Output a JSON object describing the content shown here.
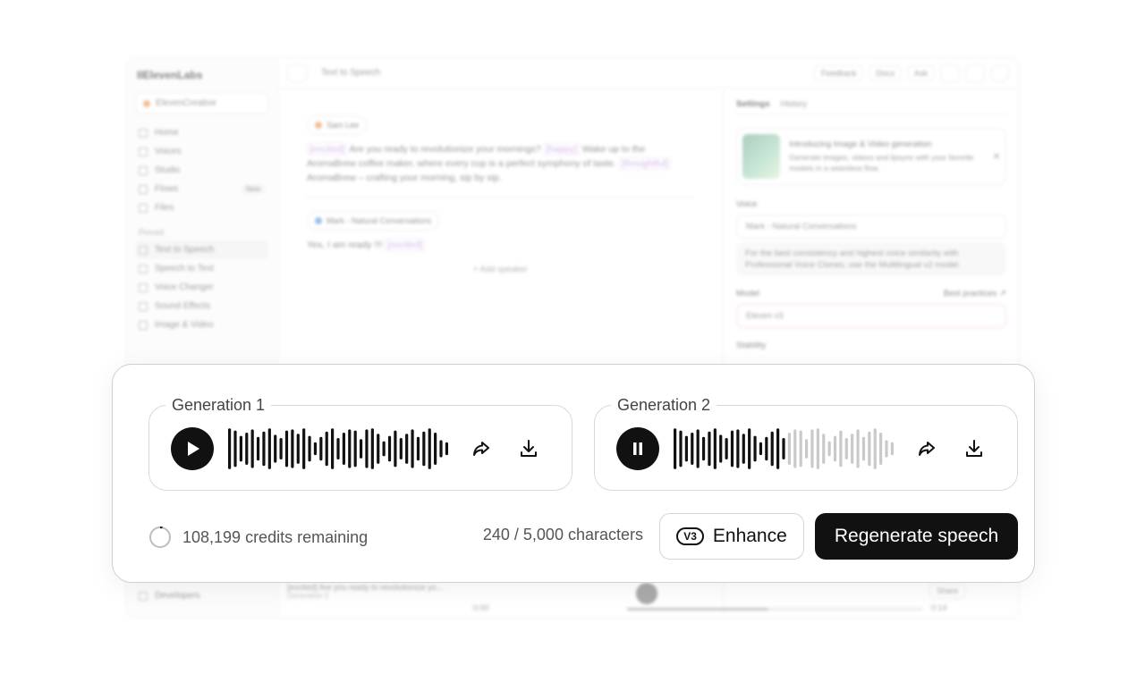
{
  "app": {
    "logo": "IIElevenLabs",
    "workspace": "ElevenCreative",
    "nav": [
      {
        "label": "Home"
      },
      {
        "label": "Voices"
      },
      {
        "label": "Studio"
      },
      {
        "label": "Flows",
        "badge": "New"
      }
    ],
    "files_label": "Files",
    "pinned_title": "Pinned",
    "pinned": [
      {
        "label": "Text to Speech",
        "active": true
      },
      {
        "label": "Speech to Text"
      },
      {
        "label": "Voice Changer"
      },
      {
        "label": "Sound Effects"
      },
      {
        "label": "Image & Video"
      }
    ],
    "developers_label": "Developers",
    "page_title": "Text to Speech",
    "top_actions": {
      "feedback": "Feedback",
      "docs": "Docs",
      "ask": "Ask"
    }
  },
  "editor": {
    "speaker1": "Sam Lee",
    "speaker1_tag1": "[excited]",
    "speaker1_text1": "Are you ready to revolutionize your mornings?",
    "speaker1_tag2": "[happy]",
    "speaker1_text2": "Wake up to the AromaBrew coffee maker, where every cup is a perfect symphony of taste.",
    "speaker1_tag3": "[thoughtful]",
    "speaker1_text3": "AromaBrew – crafting your morning, sip by sip.",
    "speaker2": "Mark - Natural Conversations",
    "speaker2_text": "Yes, I am ready !!!",
    "speaker2_tag": "[excited]",
    "add_speaker": "+ Add speaker"
  },
  "settings": {
    "tabs": [
      "Settings",
      "History"
    ],
    "promo_title": "Introducing Image & Video generation",
    "promo_text": "Generate images, videos and lipsync with your favorite models in a seamless flow.",
    "voice_label": "Voice",
    "voice_value": "Mark - Natural Conversations",
    "voice_note": "For the best consistency and highest voice similarity with Professional Voice Clones, use the Multilingual v2 model.",
    "model_label": "Model",
    "best_practices": "Best practices ↗",
    "model_value": "Eleven v3",
    "stability_label": "Stability"
  },
  "player": {
    "now_playing": "[excited] Are you ready to revolutionize yo...",
    "subtitle": "Generation 2",
    "time_start": "0:00",
    "time_end": "0:14",
    "share": "Share",
    "progress": 0.48
  },
  "generations": [
    {
      "label": "Generation 1",
      "state": "paused",
      "played_fraction": 1.0
    },
    {
      "label": "Generation 2",
      "state": "playing",
      "played_fraction": 0.5
    }
  ],
  "footer": {
    "credits": "108,199 credits remaining",
    "characters": "240 / 5,000 characters",
    "enhance_badge": "V3",
    "enhance_label": "Enhance",
    "regenerate_label": "Regenerate speech"
  }
}
